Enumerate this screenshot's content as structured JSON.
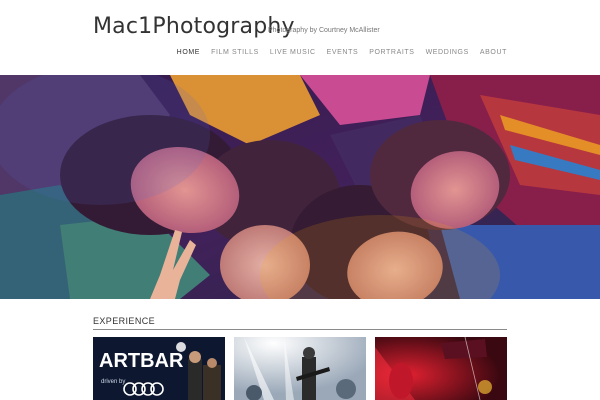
{
  "site": {
    "title": "Mac1Photography",
    "tagline": "Photography by Courtney McAllister"
  },
  "nav": {
    "items": [
      {
        "label": "HOME",
        "active": true
      },
      {
        "label": "FILM STILLS",
        "active": false
      },
      {
        "label": "LIVE MUSIC",
        "active": false
      },
      {
        "label": "EVENTS",
        "active": false
      },
      {
        "label": "PORTRAITS",
        "active": false
      },
      {
        "label": "WEDDINGS",
        "active": false
      },
      {
        "label": "ABOUT",
        "active": false
      }
    ]
  },
  "section": {
    "heading": "EXPERIENCE"
  },
  "thumbnails": {
    "first": {
      "sign_text": "ARTBAR",
      "sponsor_text": "driven by"
    }
  }
}
